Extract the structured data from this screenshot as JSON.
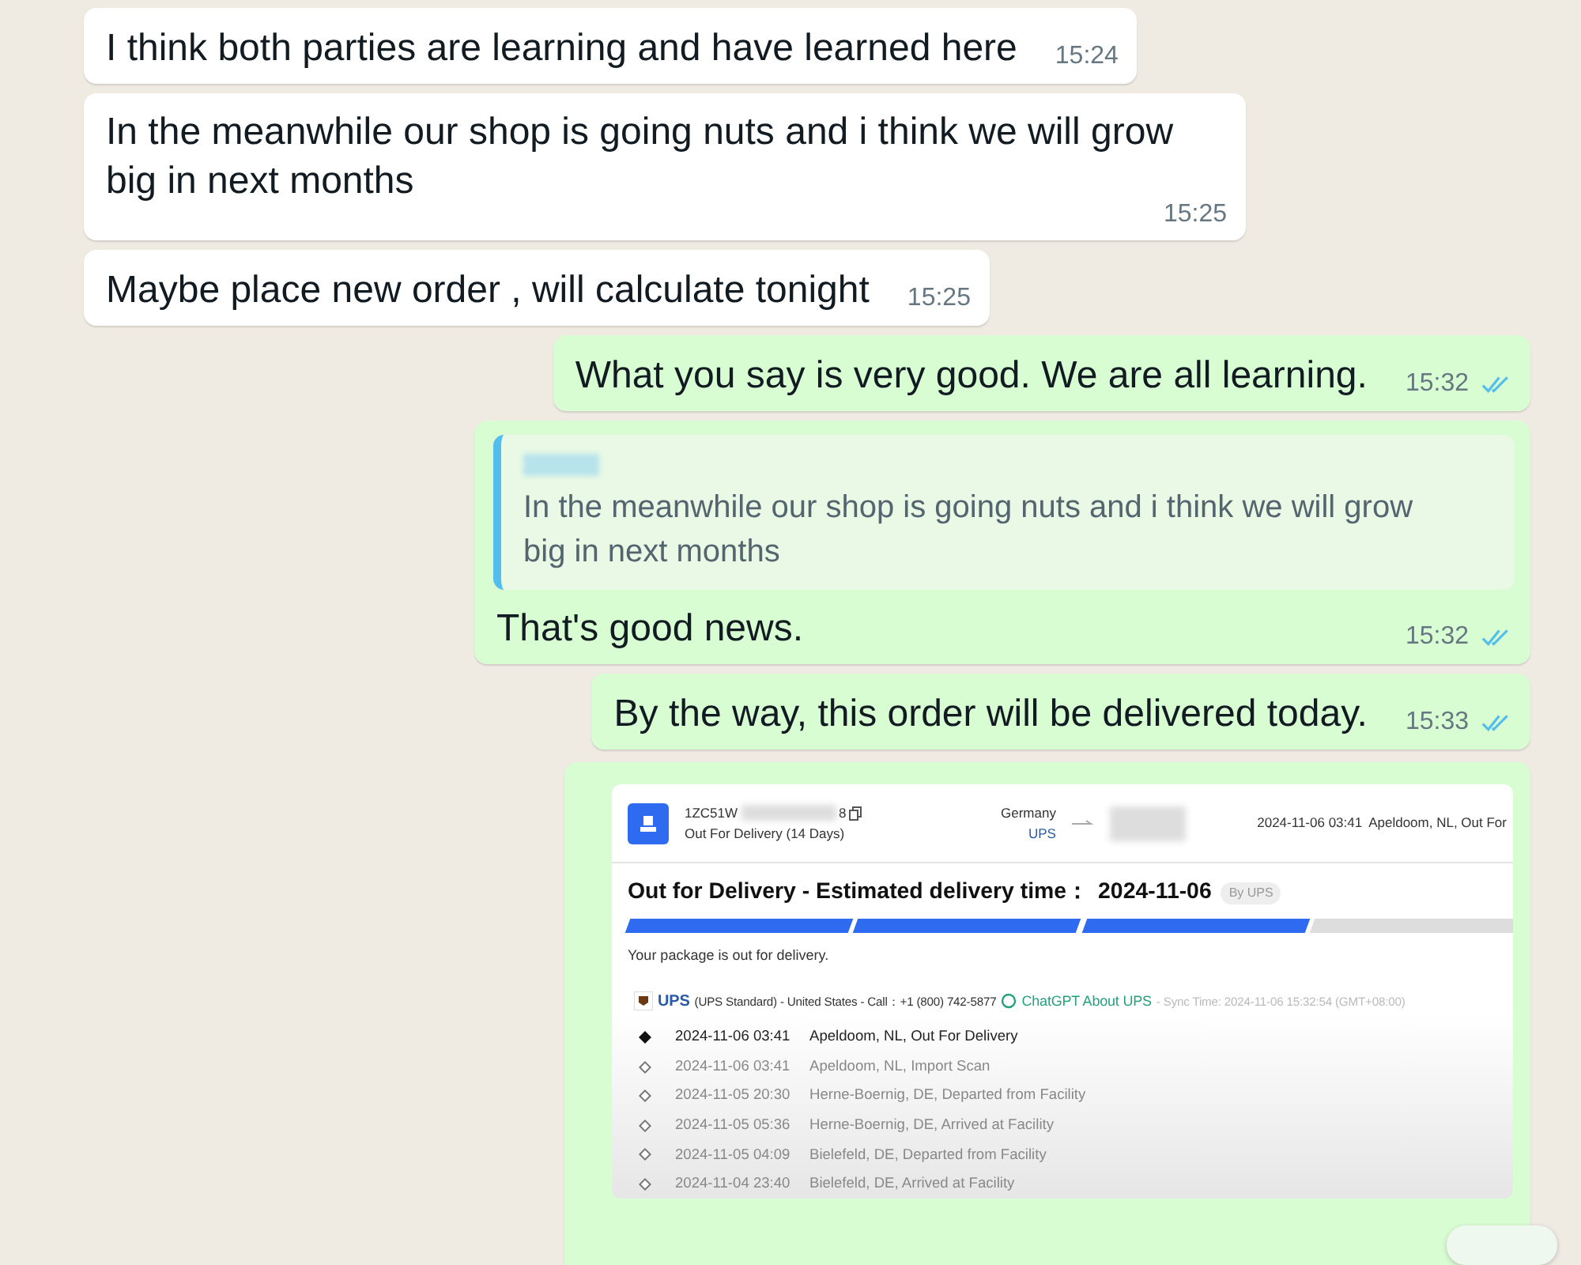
{
  "messages": [
    {
      "kind": "incoming",
      "text": "I think both parties are learning and have learned here",
      "time": "15:24"
    },
    {
      "kind": "incoming",
      "text": "In the meanwhile our shop is going nuts and i think we will grow big in next months",
      "time": "15:25"
    },
    {
      "kind": "incoming",
      "text": "Maybe place new order , will calculate tonight",
      "time": "15:25"
    },
    {
      "kind": "outgoing",
      "text": "What you say is very good. We are all learning.",
      "time": "15:32",
      "read": true
    },
    {
      "kind": "outgoing",
      "quote": {
        "text": "In the meanwhile our shop is going nuts and i think we will grow big in next months"
      },
      "text": "That's good news.",
      "time": "15:32",
      "read": true
    },
    {
      "kind": "outgoing",
      "text": "By the way, this order will be delivered today.",
      "time": "15:33",
      "read": true
    },
    {
      "kind": "attachment",
      "tracking": {
        "number_start": "1ZC51W",
        "number_end": "8",
        "status": "Out For Delivery (14 Days)",
        "origin": "Germany",
        "carrier_link": "UPS",
        "latest_time": "2024-11-06 03:41",
        "latest_place": "Apeldoom, NL, Out For",
        "headline": "Out for Delivery - Estimated delivery time：",
        "date": "2024-11-06",
        "badge": "By UPS",
        "level": 0.75,
        "message": "Your package is out for delivery.",
        "carrier": "UPS",
        "service": "(UPS Standard) - United States - Call：+1 (800) 742-5877",
        "ai_link": "ChatGPT About UPS",
        "sync": "- Sync Time: 2024-11-06 15:32:54 (GMT+08:00)",
        "events": [
          {
            "time": "2024-11-06 03:41",
            "place": "Apeldoom, NL, Out For Delivery",
            "latest": true
          },
          {
            "time": "2024-11-06 03:41",
            "place": "Apeldoom, NL, Import Scan",
            "latest": false
          },
          {
            "time": "2024-11-05 20:30",
            "place": "Herne-Boernig, DE, Departed from Facility",
            "latest": false
          },
          {
            "time": "2024-11-05 05:36",
            "place": "Herne-Boernig, DE, Arrived at Facility",
            "latest": false
          },
          {
            "time": "2024-11-05 04:09",
            "place": "Bielefeld, DE, Departed from Facility",
            "latest": false
          },
          {
            "time": "2024-11-04 23:40",
            "place": "Bielefeld, DE, Arrived at Facility",
            "latest": false
          }
        ]
      }
    }
  ]
}
